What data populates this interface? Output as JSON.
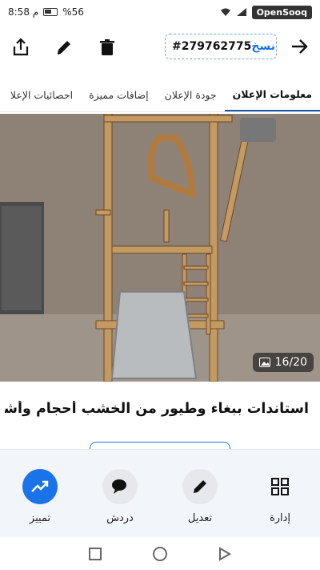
{
  "status_bar": {
    "time": "8:58 م",
    "battery": "%56",
    "brand": "OpenSooq"
  },
  "header": {
    "ad_number": "#279762775",
    "copy_label": "نسخ"
  },
  "tabs": [
    {
      "label": "معلومات الإعلان",
      "active": true
    },
    {
      "label": "جودة الإعلان",
      "active": false
    },
    {
      "label": "إضافات مميزة",
      "active": false
    },
    {
      "label": "احصائيات الإعلا",
      "active": false
    }
  ],
  "photo": {
    "counter": "16/20"
  },
  "ad_title": "استاندات ببغاء وطيور من الخشب أحجام وأشكا...",
  "actions": [
    {
      "label": "إدارة",
      "icon": "grid-icon"
    },
    {
      "label": "تعديل",
      "icon": "pencil-icon"
    },
    {
      "label": "دردش",
      "icon": "chat-icon"
    },
    {
      "label": "تمييز",
      "icon": "trending-up-icon"
    }
  ],
  "colors": {
    "accent": "#1a73e8",
    "tab_indicator": "#1a56b0"
  }
}
